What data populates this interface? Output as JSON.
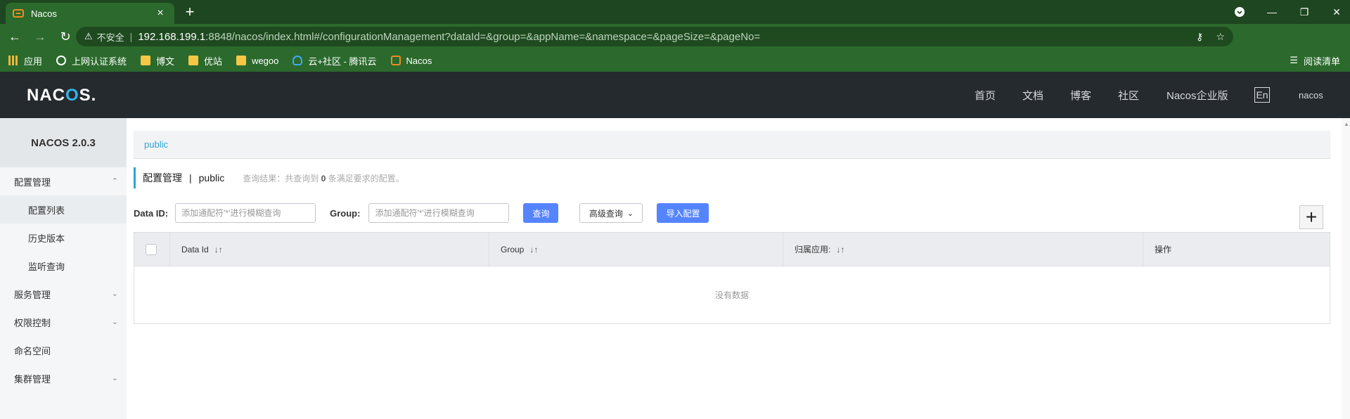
{
  "browser": {
    "tab_title": "Nacos",
    "tab_close": "×",
    "new_tab": "+",
    "address_insecure": "不安全",
    "address_host": "192.168.199.1",
    "address_path": ":8848/nacos/index.html#/configurationManagement?dataId=&group=&appName=&namespace=&pageSize=&pageNo=",
    "bookmarks": [
      {
        "label": "应用",
        "icon": "apps-icon"
      },
      {
        "label": "上网认证系统",
        "icon": "globe-icon"
      },
      {
        "label": "博文",
        "icon": "folder-icon"
      },
      {
        "label": "优站",
        "icon": "folder-icon"
      },
      {
        "label": "wegoo",
        "icon": "folder-icon"
      },
      {
        "label": "云+社区 - 腾讯云",
        "icon": "cloud-icon"
      },
      {
        "label": "Nacos",
        "icon": "nacos-icon"
      }
    ],
    "reading_list": "阅读清单"
  },
  "header": {
    "logo_pre": "NAC",
    "logo_o": "O",
    "logo_post": "S.",
    "menu": [
      "首页",
      "文档",
      "博客",
      "社区",
      "Nacos企业版"
    ],
    "lang": "En",
    "user": "nacos"
  },
  "sidebar": {
    "title": "NACOS 2.0.3",
    "items": [
      {
        "label": "配置管理",
        "chevron": "up"
      },
      {
        "label": "配置列表"
      },
      {
        "label": "历史版本"
      },
      {
        "label": "监听查询"
      },
      {
        "label": "服务管理",
        "chevron": "down"
      },
      {
        "label": "权限控制",
        "chevron": "down"
      },
      {
        "label": "命名空间"
      },
      {
        "label": "集群管理",
        "chevron": "down"
      }
    ]
  },
  "content": {
    "namespace_tab": "public",
    "page_title": "配置管理",
    "page_separator": "|",
    "page_namespace": "public",
    "hint_prefix": "查询结果：共查询到",
    "hint_count": "0",
    "hint_suffix": "条满足要求的配置。",
    "filters": {
      "dataid_label": "Data ID:",
      "dataid_placeholder": "添加通配符'*'进行模糊查询",
      "group_label": "Group:",
      "group_placeholder": "添加通配符'*'进行模糊查询",
      "query_button": "查询",
      "advanced_button": "高级查询",
      "import_button": "导入配置"
    },
    "add_button": "+",
    "table": {
      "columns": [
        "Data Id",
        "Group",
        "归属应用:",
        "操作"
      ],
      "empty_text": "没有数据"
    }
  },
  "colors": {
    "chrome_dark": "#1e4620",
    "chrome": "#2b6a2c",
    "header_bg": "#252a2f",
    "accent": "#2ba6d5",
    "primary_button": "#5584ff"
  }
}
